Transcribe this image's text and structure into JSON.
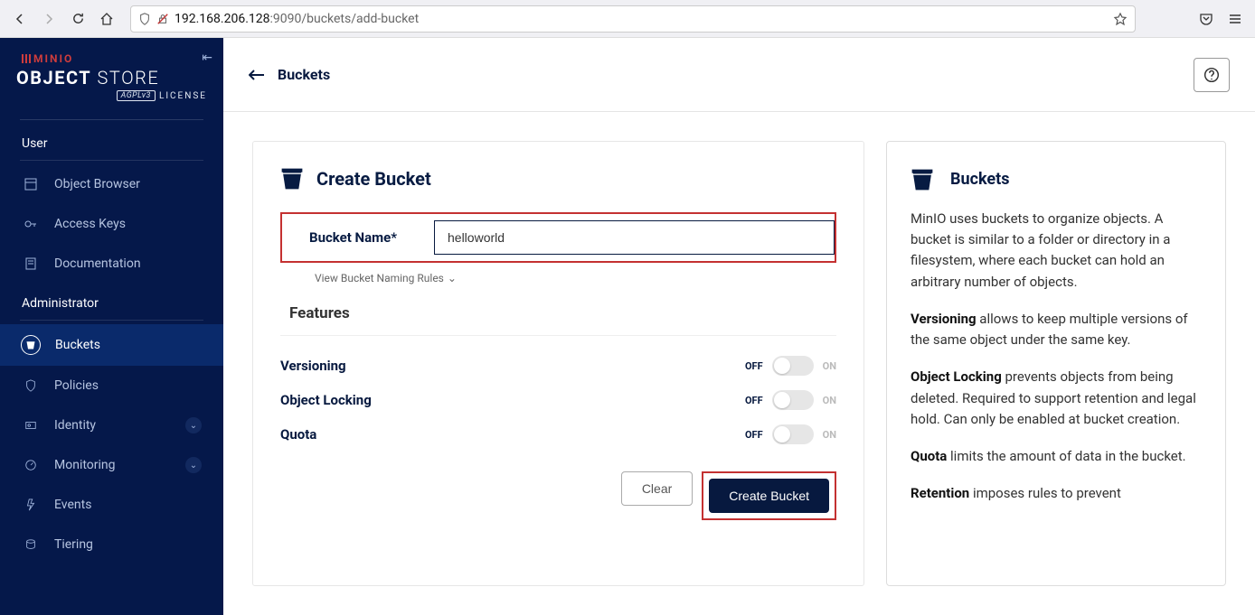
{
  "browser": {
    "url_prefix": "192.168.206.128",
    "url_suffix": ":9090/buckets/add-bucket"
  },
  "logo": {
    "minio": "MINIO",
    "object": "OBJECT",
    "store": "STORE",
    "license_badge": "AGPLv3",
    "license": "LICENSE"
  },
  "sidebar": {
    "section_user": "User",
    "items_user": [
      {
        "label": "Object Browser"
      },
      {
        "label": "Access Keys"
      },
      {
        "label": "Documentation"
      }
    ],
    "section_admin": "Administrator",
    "items_admin": [
      {
        "label": "Buckets"
      },
      {
        "label": "Policies"
      },
      {
        "label": "Identity"
      },
      {
        "label": "Monitoring"
      },
      {
        "label": "Events"
      },
      {
        "label": "Tiering"
      }
    ]
  },
  "header": {
    "crumb": "Buckets"
  },
  "form": {
    "title": "Create Bucket",
    "name_label": "Bucket Name*",
    "name_value": "helloworld",
    "view_rules": "View Bucket Naming Rules",
    "features_title": "Features",
    "off": "OFF",
    "on": "ON",
    "features": [
      {
        "label": "Versioning"
      },
      {
        "label": "Object Locking"
      },
      {
        "label": "Quota"
      }
    ],
    "buttons": {
      "clear": "Clear",
      "create": "Create Bucket"
    }
  },
  "info": {
    "title": "Buckets",
    "p1": "MinIO uses buckets to organize objects. A bucket is similar to a folder or directory in a filesystem, where each bucket can hold an arbitrary number of objects.",
    "versioning_b": "Versioning",
    "versioning_t": " allows to keep multiple versions of the same object under the same key.",
    "objlock_b": "Object Locking",
    "objlock_t": " prevents objects from being deleted. Required to support retention and legal hold. Can only be enabled at bucket creation.",
    "quota_b": "Quota",
    "quota_t": " limits the amount of data in the bucket.",
    "retention_b": "Retention",
    "retention_t": " imposes rules to prevent"
  }
}
